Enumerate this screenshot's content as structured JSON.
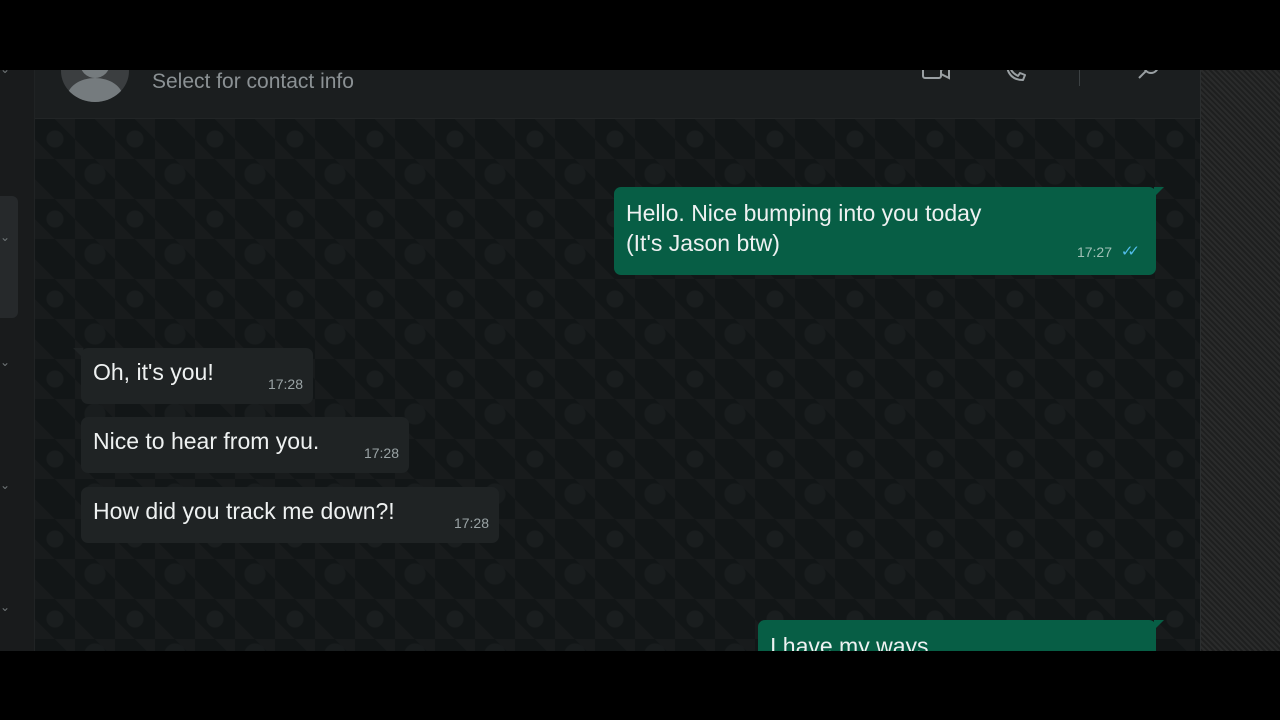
{
  "header": {
    "subtitle": "Select for contact info",
    "icons": [
      "video-call-icon",
      "voice-call-icon",
      "search-icon"
    ]
  },
  "messages": [
    {
      "direction": "out",
      "text": "Hello. Nice bumping into you today\n(It's Jason btw)",
      "time": "17:27",
      "status": "read"
    },
    {
      "direction": "in",
      "text": "Oh, it's you!",
      "time": "17:28"
    },
    {
      "direction": "in",
      "text": "Nice to hear from you.",
      "time": "17:28"
    },
    {
      "direction": "in",
      "text": "How did you track me down?!",
      "time": "17:28"
    },
    {
      "direction": "out",
      "text": "I have my ways",
      "time": ""
    }
  ],
  "colors": {
    "outgoing_bubble": "#075e45",
    "incoming_bubble": "#1f2324",
    "read_ticks": "#53bdeb"
  }
}
